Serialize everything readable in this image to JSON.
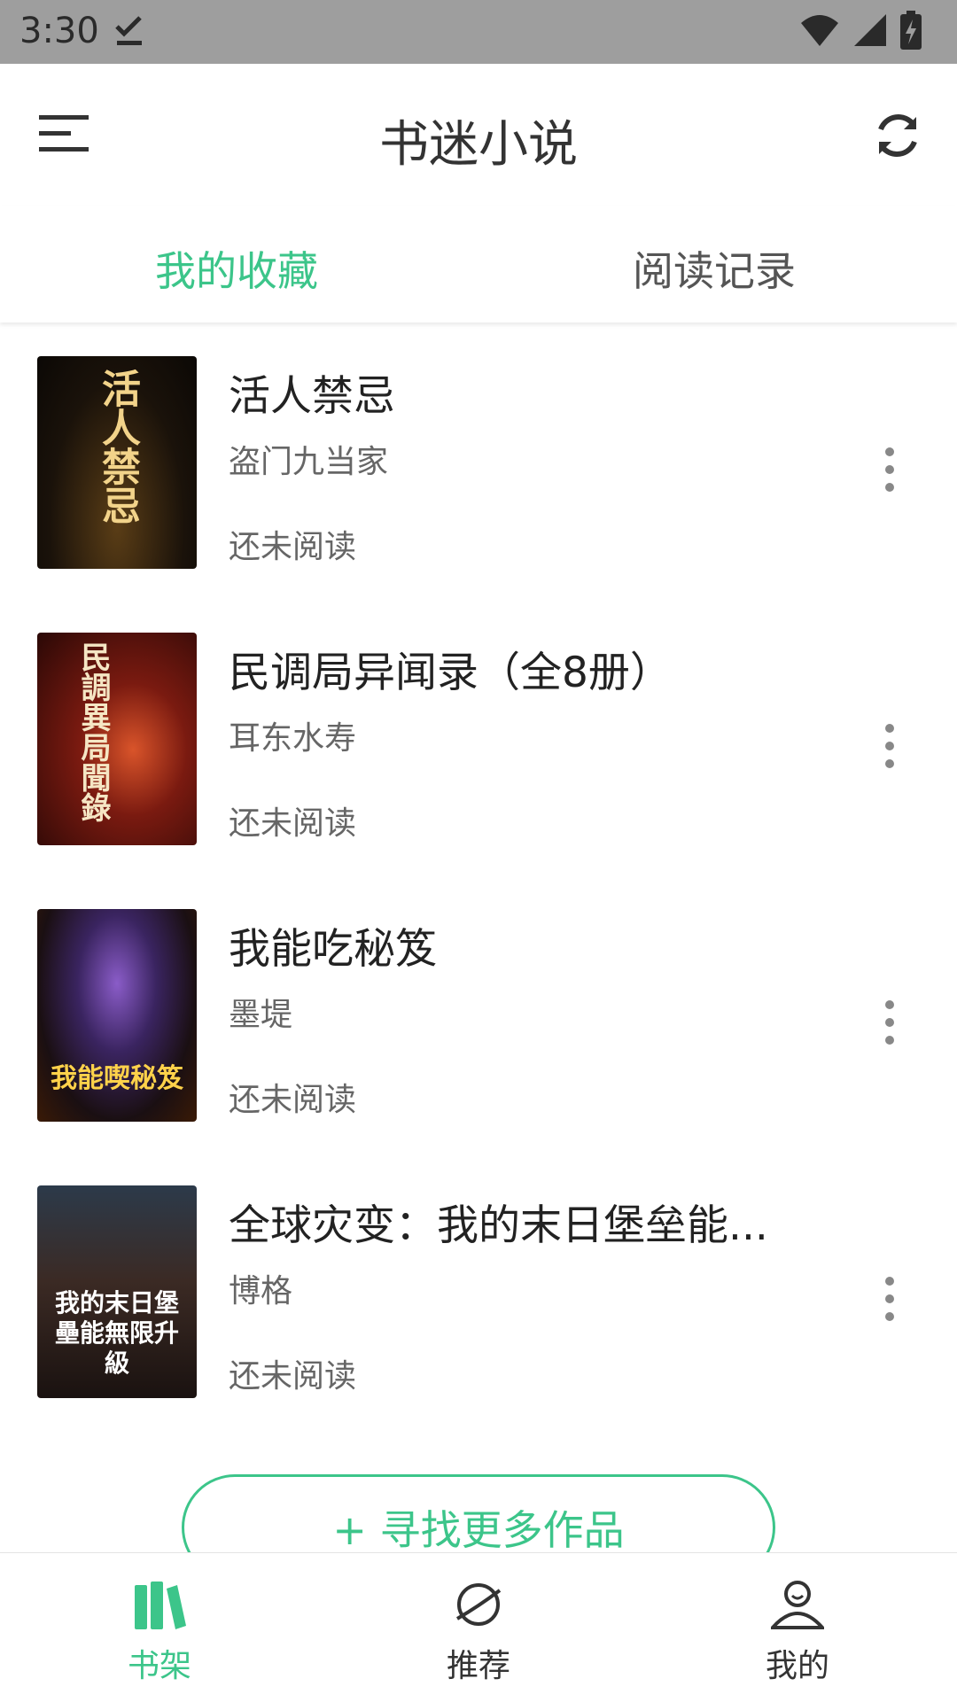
{
  "status_bar": {
    "time": "3:30"
  },
  "app_bar": {
    "title": "书迷小说"
  },
  "tabs": [
    {
      "label": "我的收藏",
      "active": true
    },
    {
      "label": "阅读记录",
      "active": false
    }
  ],
  "books": [
    {
      "title": "活人禁忌",
      "author": "盗门九当家",
      "progress": "还未阅读",
      "cover_text": "活人禁忌"
    },
    {
      "title": "民调局异闻录（全8册）",
      "author": "耳东水寿",
      "progress": "还未阅读",
      "cover_text": "民調異局聞錄"
    },
    {
      "title": "我能吃秘笈",
      "author": "墨堤",
      "progress": "还未阅读",
      "cover_text": "我能喫秘笈"
    },
    {
      "title": "全球灾变：我的末日堡垒能...",
      "author": "博格",
      "progress": "还未阅读",
      "cover_text": "我的末日堡壘能無限升級"
    }
  ],
  "find_more_button": "+ 寻找更多作品",
  "bottom_nav": [
    {
      "label": "书架",
      "icon": "bookshelf-icon",
      "active": true
    },
    {
      "label": "推荐",
      "icon": "planet-icon",
      "active": false
    },
    {
      "label": "我的",
      "icon": "user-icon",
      "active": false
    }
  ],
  "colors": {
    "accent": "#3cc58a",
    "status_bar": "#9e9e9e"
  }
}
